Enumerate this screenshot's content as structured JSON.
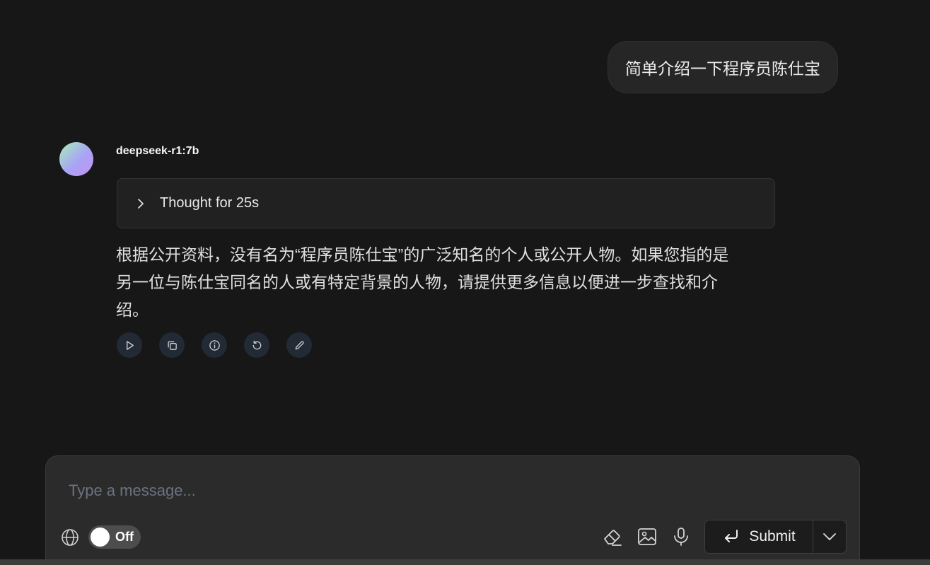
{
  "conversation": {
    "user_message": "简单介绍一下程序员陈仕宝",
    "assistant": {
      "model_name": "deepseek-r1:7b",
      "thought_label": "Thought for 25s",
      "answer": "根据公开资料，没有名为“程序员陈仕宝”的广泛知名的个人或公开人物。如果您指的是另一位与陈仕宝同名的人或有特定背景的人物，请提供更多信息以便进一步查找和介绍。",
      "actions": [
        "play-icon",
        "copy-icon",
        "info-icon",
        "regenerate-icon",
        "edit-icon"
      ]
    }
  },
  "composer": {
    "placeholder": "Type a message...",
    "value": "",
    "web_search_toggle": "Off",
    "submit_label": "Submit"
  },
  "colors": {
    "background": "#171717",
    "bubble": "#262626",
    "composer": "#2b2b2b",
    "action_button": "#222a36"
  }
}
